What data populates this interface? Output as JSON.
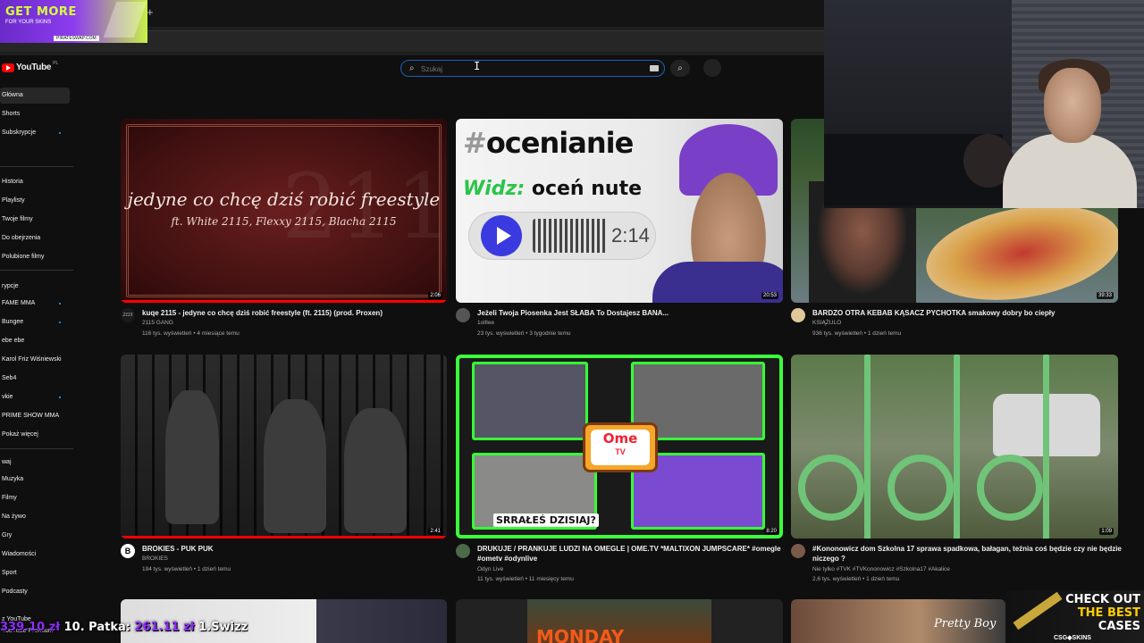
{
  "ad_banner": {
    "headline": "GET MORE",
    "tagline": "FOR YOUR SKINS",
    "site": "PIRATESWAP.COM"
  },
  "browser": {
    "new_tab_symbol": "+"
  },
  "header": {
    "logo_text": "YouTube",
    "region": "PL",
    "search_placeholder": "Szukaj"
  },
  "sidebar": {
    "items": [
      {
        "label": "Główna",
        "active": true
      },
      {
        "label": "Shorts"
      },
      {
        "label": "Subskrypcje"
      },
      {
        "label": "Historia"
      },
      {
        "label": "Playlisty"
      },
      {
        "label": "Twoje filmy"
      },
      {
        "label": "Do obejrzenia"
      },
      {
        "label": "Polubione filmy"
      },
      {
        "label": "rypcje"
      },
      {
        "label": "FAME MMA"
      },
      {
        "label": "Bungee"
      },
      {
        "label": "ebe ebe"
      },
      {
        "label": "Karol Friz Wiśniewski"
      },
      {
        "label": "Seb4"
      },
      {
        "label": "vkie"
      },
      {
        "label": "PRIME SHOW MMA"
      },
      {
        "label": "Pokaż więcej"
      },
      {
        "label": "waj"
      },
      {
        "label": "Muzyka"
      },
      {
        "label": "Filmy"
      },
      {
        "label": "Na żywo"
      },
      {
        "label": "Gry"
      },
      {
        "label": "Wiadomości"
      },
      {
        "label": "Sport"
      },
      {
        "label": "Podcasty"
      }
    ],
    "bottom": [
      "z YouTube",
      "YouTube Premium"
    ]
  },
  "videos": [
    {
      "title": "kuqe 2115 - jedyne co chcę dziś robić freestyle (ft. 2115) (prod. Proxen)",
      "channel": "2115 GANG",
      "meta": "116 tys. wyświetleń • 4 miesiące temu",
      "duration": "2:06",
      "watched": 1.0,
      "avatar_text": "2115",
      "art": {
        "line1": "jedyne co chcę dziś robić freestyle",
        "line2": "ft. White 2115, Flexxy 2115, Blacha 2115",
        "mark": "2115"
      }
    },
    {
      "title": "Jeżeli Twoja Piosenka Jest SŁABA To Dostajesz BANA...",
      "channel": "1ollIee",
      "meta": "23 tys. wyświetleń • 3 tygodnie temu",
      "duration": "20:53",
      "watched": 0,
      "art": {
        "hash": "#",
        "word": "ocenianie",
        "widz": "Widz:",
        "rest": "oceń nute",
        "time": "2:14"
      }
    },
    {
      "title": "BARDZO OTRA KEBAB KĄSACZ PYCHOTKA smakowy dobry bo ciepły",
      "channel": "KSIĄŻULO",
      "meta": "936 tys. wyświetleń • 1 dzień temu",
      "duration": "39:33",
      "watched": 0
    },
    {
      "title": "BROKIES - PUK PUK",
      "channel": "BROKIES",
      "meta": "194 tys. wyświetleń • 1 dzień temu",
      "duration": "2:41",
      "watched": 1.0,
      "avatar_text": "B"
    },
    {
      "title": "DRUKUJE / PRANKUJE LUDZI NA OMEGLE | OME.TV *MALTIXON JUMPSCARE* #omegle #ometv #odynlive",
      "channel": "Odyn Live",
      "meta": "11 tys. wyświetleń • 11 miesięcy temu",
      "duration": "8:20",
      "watched": 0,
      "art": {
        "tv1": "Ome",
        "tv2": "TV",
        "caption": "SRRAŁEŚ DZISIAJ?"
      }
    },
    {
      "title": "#Kononowicz dom Szkolna 17 sprawa spadkowa, bałagan, teźnia coś będzie czy nie będzie niczego ?",
      "channel": "Nie tylko #TVK #TVKononowicz #Szkolna17 #Akalice",
      "meta": "2,6 tys. wyświetleń • 1 dzień temu",
      "duration": "1:09",
      "watched": 0
    }
  ],
  "bottom_row": {
    "monday_text": "MONDAY",
    "pretty_boy": "Pretty Boy"
  },
  "overlay": {
    "ticker": [
      {
        "amount": "339.10 zł",
        "text": ""
      },
      {
        "amount": "",
        "text": "10. Patka: "
      },
      {
        "amount": "261.11 zł",
        "text": ""
      },
      {
        "amount": "",
        "text": "  1.Swizz"
      }
    ],
    "csg": {
      "line1": "CHECK OUT",
      "line2": "THE BEST",
      "line3": "CASES",
      "brand": "CSG◆SKINS"
    }
  },
  "colors": {
    "accent": "#ff0000",
    "search_border": "#1c62b9",
    "ticker_purple": "#8e2cff"
  }
}
